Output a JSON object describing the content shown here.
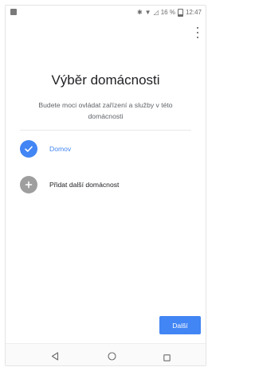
{
  "status_bar": {
    "battery_text": "16 %",
    "time": "12:47",
    "icons": [
      "notification-icon",
      "bluetooth-icon",
      "wifi-icon",
      "signal-icon",
      "battery-icon"
    ]
  },
  "header": {
    "title": "Výběr domácnosti",
    "subtitle": "Budete moci ovládat zařízení a služby v této domácnosti"
  },
  "homes": [
    {
      "label": "Domov",
      "selected": true,
      "icon": "check-icon"
    },
    {
      "label": "Přidat další domácnost",
      "selected": false,
      "icon": "plus-icon"
    }
  ],
  "next_button": {
    "label": "Další"
  },
  "nav_bar": {
    "icons": [
      "back-icon",
      "home-icon",
      "recents-icon"
    ]
  },
  "colors": {
    "accent": "#4285f4",
    "add_circle": "#9e9e9e",
    "text_primary": "#202124",
    "text_secondary": "#5f6368"
  }
}
